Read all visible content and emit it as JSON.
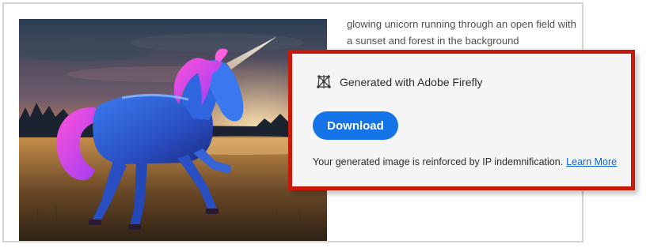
{
  "prompt": {
    "text": "glowing unicorn running through an open field with a sunset and forest in the background"
  },
  "image": {
    "subject": "glowing unicorn in field at sunset"
  },
  "card": {
    "title": "Generated with Adobe Firefly",
    "icon": "firefly-icon",
    "download_label": "Download",
    "ip_text": "Your generated image is reinforced by IP indemnification.",
    "learn_more_label": "Learn More"
  },
  "colors": {
    "highlight_border": "#c8190b",
    "primary_button": "#1473e6",
    "link": "#0d66d0",
    "card_background": "#f5f5f5"
  }
}
